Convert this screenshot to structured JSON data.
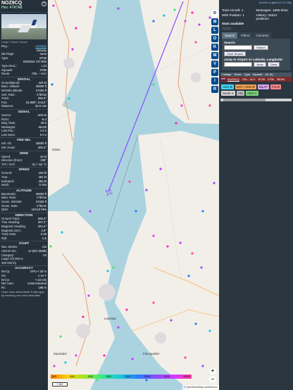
{
  "aircraft": {
    "callsign": "NOZ9CQ",
    "hex": "Hex: 47A7A8",
    "photo_credit": "Image © Martin Oswald"
  },
  "details": [
    {
      "k": "Reg.:",
      "v": "LN-NOZ",
      "link": true
    },
    {
      "k": "",
      "v": "Norway"
    },
    {
      "k": "DB Flags:",
      "v": "none"
    },
    {
      "k": "Type:",
      "v": "B738"
    },
    {
      "k": "",
      "v": "BOEING 737-800"
    },
    {
      "k": "Type Desc.:",
      "v": "L2J"
    },
    {
      "k": "Squawk:",
      "v": "0756"
    },
    {
      "k": "Route:",
      "v": "OSL – ALC"
    }
  ],
  "sections": [
    {
      "title": "SPATIAL",
      "rows": [
        {
          "k": "Groundspeed:",
          "v": "443 kt"
        },
        {
          "k": "Baro. Altitude:",
          "v": "36000 ft"
        },
        {
          "k": "WGS84 altitude:",
          "v": "37425 ft"
        },
        {
          "k": "Vert. Rate:",
          "v": "0 ft/min"
        },
        {
          "k": "Track:",
          "v": "206.3°"
        },
        {
          "k": "Pos.:",
          "v": "52.698°, 5.514°"
        },
        {
          "k": "Distance:",
          "v": "32.5 nmi"
        }
      ]
    },
    {
      "title": "SIGNAL",
      "rows": [
        {
          "k": "Source:",
          "v": "ADS-B"
        },
        {
          "k": "RSSI:",
          "v": "-6.3"
        },
        {
          "k": "Msg. Rate:",
          "v": "26.0"
        },
        {
          "k": "Messages:",
          "v": "46126"
        },
        {
          "k": "Last Pos.:",
          "v": "1.0 s"
        },
        {
          "k": "Last Seen:",
          "v": "0.0 s"
        }
      ]
    },
    {
      "title": "FMS SEL",
      "rows": [
        {
          "k": "Sel. Alt.:",
          "v": "36000 ft"
        },
        {
          "k": "Sel. Head.:",
          "v": "205.3°"
        }
      ]
    },
    {
      "title": "WIND",
      "rows": [
        {
          "k": "Speed:",
          "v": "15 kt"
        },
        {
          "k": "Direction (from):",
          "v": "238°"
        },
        {
          "k": "TAT / OAT:",
          "v": "-21 / -52 °C"
        }
      ]
    },
    {
      "title": "SPEED",
      "rows": [
        {
          "k": "Ground:",
          "v": "443 kt"
        },
        {
          "k": "True:",
          "v": "454 kt"
        },
        {
          "k": "Indicated:",
          "v": "260 kt"
        },
        {
          "k": "Mach:",
          "v": "0.784"
        }
      ]
    },
    {
      "title": "ALTITUDE",
      "rows": [
        {
          "k": "Barometric:",
          "v": "36000 ft"
        },
        {
          "k": "Baro. Rate:",
          "v": "0 ft/min"
        },
        {
          "k": "Geom. WGS84:",
          "v": "37425 ft"
        },
        {
          "k": "Geom. Rate:",
          "v": "0 ft/min"
        },
        {
          "k": "QNH:",
          "v": "1013.6 hPa"
        }
      ]
    },
    {
      "title": "DIRECTION",
      "rows": [
        {
          "k": "Ground Track:",
          "v": "206.3°"
        },
        {
          "k": "True Heading:",
          "v": "207.2°"
        },
        {
          "k": "Magnetic Heading:",
          "v": "204.4°"
        },
        {
          "k": "Magnetic Decl.:",
          "v": "2.9°"
        },
        {
          "k": "Track Rate:",
          "v": "0.00"
        },
        {
          "k": "Roll:",
          "v": "0.5"
        }
      ]
    },
    {
      "title": "STUFF",
      "rows": [
        {
          "k": "Nav. Modes:",
          "v": "n/a"
        },
        {
          "k": "ADS-B Ver.:",
          "v": "v2 (DO-260B)"
        },
        {
          "k": "Category:",
          "v": "A3"
        },
        {
          "k": "Large (75 000 to",
          "v": ""
        },
        {
          "k": "300 000 lb)",
          "v": ""
        }
      ]
    },
    {
      "title": "ACCURACY",
      "rows": [
        {
          "k": "NACp:",
          "v": "EPU < 30 m"
        },
        {
          "k": "SIL:",
          "v": "≤ 1e-7"
        },
        {
          "k": "NACv:",
          "v": "< 10 m/s"
        },
        {
          "k": "NIC baro:",
          "v": "cross-checked"
        },
        {
          "k": "Rc:",
          "v": "186 m"
        }
      ]
    }
  ],
  "help_note": "Learn more about Mode S data type by hovering over each data label.",
  "map": {
    "top_buttons": [
      "U",
      "N",
      "T"
    ],
    "side_buttons": [
      "L",
      "O",
      "K",
      "M",
      "V",
      "P",
      "I",
      "R"
    ],
    "altitude_legend": [
      "2000",
      "4000",
      "6000",
      "8000",
      "10000",
      "20000",
      "30000",
      "40000+"
    ],
    "scale": "1 NM",
    "attribution": "© OpenStreetMap contributors.",
    "city_labels": [
      "Lelystad",
      "Flevopolder",
      "Edam",
      "Zaandam"
    ]
  },
  "sidebar": {
    "version_link": "tar1090 on github (3.14.1756)",
    "stats": {
      "total_aircraft": "Total Aircraft: 1",
      "messages": "Messages: 1806.6/sec",
      "with_position": "With Position: 1",
      "history": "History: 24613 positions"
    },
    "stats_available": "Stats available",
    "tabs": [
      "Search",
      "Filters",
      "Columns"
    ],
    "search_label": "Search:",
    "search_button": "Search",
    "clear_search": "Clear Search",
    "jump_label": "Jump to Airport or Latitude, Longitude:",
    "jump_button": "Jump",
    "clear_button": "Clear",
    "table_headers": [
      "Callsign",
      "Route",
      "Type",
      "Squawk",
      "Alt. (ft)"
    ],
    "table_row": {
      "callsign": "NOZ9CQ",
      "route": "OSL - ALC",
      "type": "B738",
      "squawk": "0756",
      "alt": "36000"
    },
    "chips": [
      {
        "label": "ADS-B",
        "color": "#3fd8ff"
      },
      {
        "label": "UAT / ADS-R",
        "color": "#f0a050"
      },
      {
        "label": "MLAT",
        "color": "#d6a8f0"
      },
      {
        "label": "TIS-B",
        "color": "#ff8a8a"
      },
      {
        "label": "Mode-S",
        "color": "#dadada"
      },
      {
        "label": "AIS",
        "color": "#c0c0c0"
      },
      {
        "label": "ADS-C",
        "color": "#7fd67f"
      }
    ]
  }
}
